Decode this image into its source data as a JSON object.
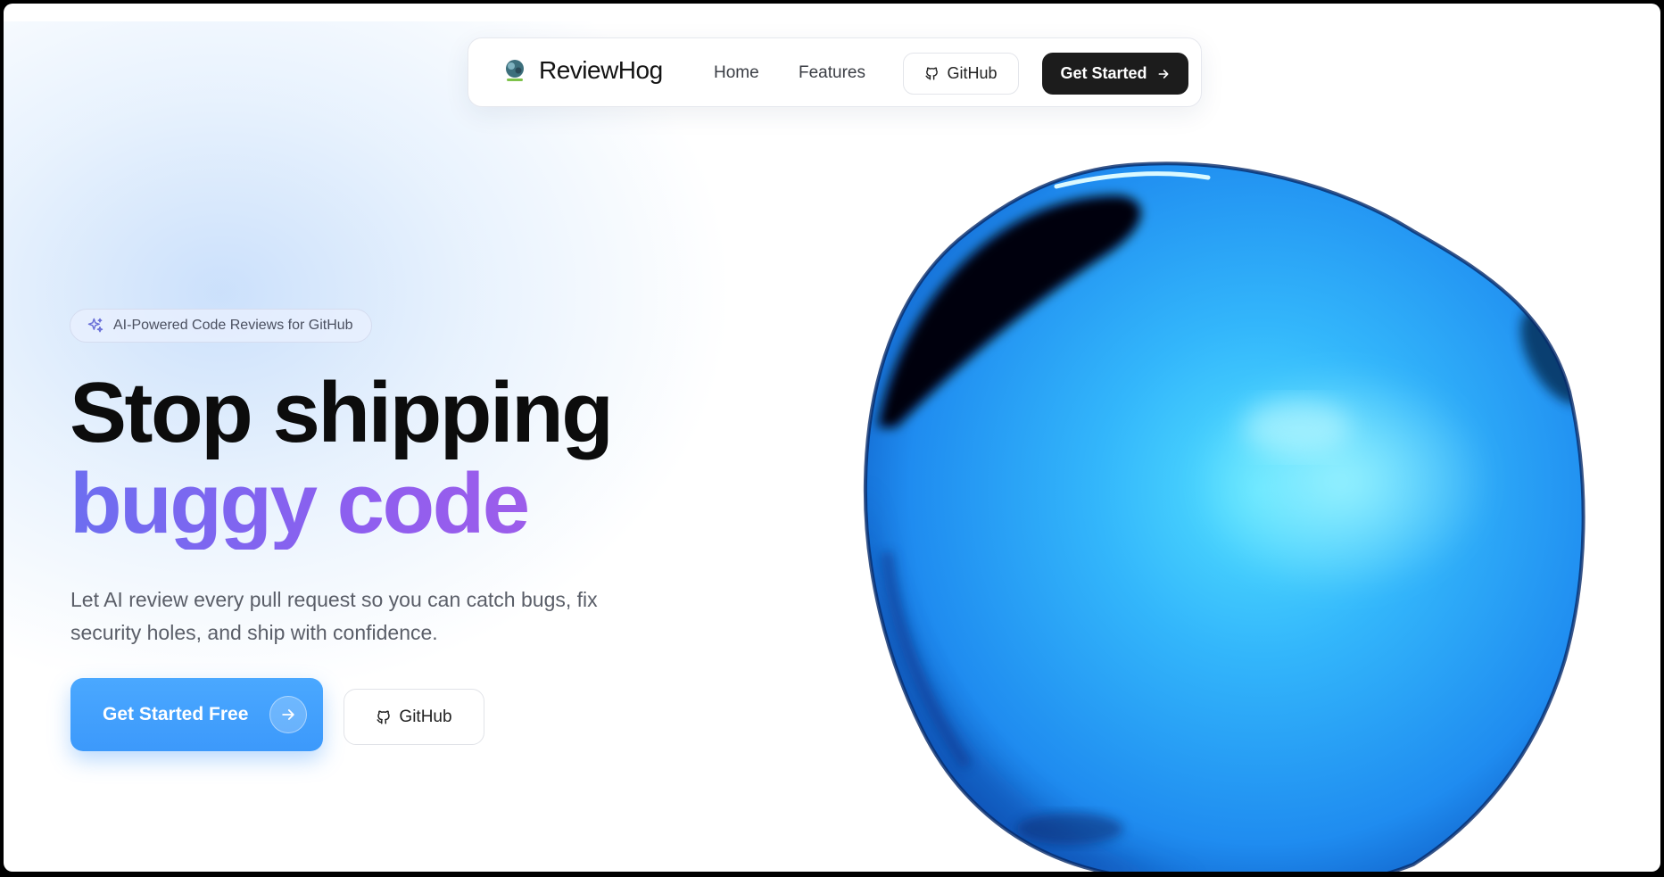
{
  "nav": {
    "brand": "ReviewHog",
    "links": [
      {
        "label": "Home"
      },
      {
        "label": "Features"
      }
    ],
    "github_label": "GitHub",
    "cta_label": "Get Started"
  },
  "hero": {
    "badge": "AI-Powered Code Reviews for GitHub",
    "headline_line1": "Stop shipping",
    "headline_line2": "buggy code",
    "subtitle": "Let AI review every pull request so you can catch bugs, fix security holes, and ship with confidence.",
    "cta_primary": "Get Started Free",
    "cta_secondary": "GitHub"
  },
  "icons": {
    "logo": "reviewhog-logo-icon",
    "github": "github-icon",
    "arrow": "arrow-right-icon",
    "sparkle": "sparkle-icon"
  },
  "colors": {
    "primary_blue": "#3c99fb",
    "headline_gradient_start": "#6d6ef0",
    "headline_gradient_end": "#a35ce8",
    "dark_button": "#1c1c1c"
  }
}
